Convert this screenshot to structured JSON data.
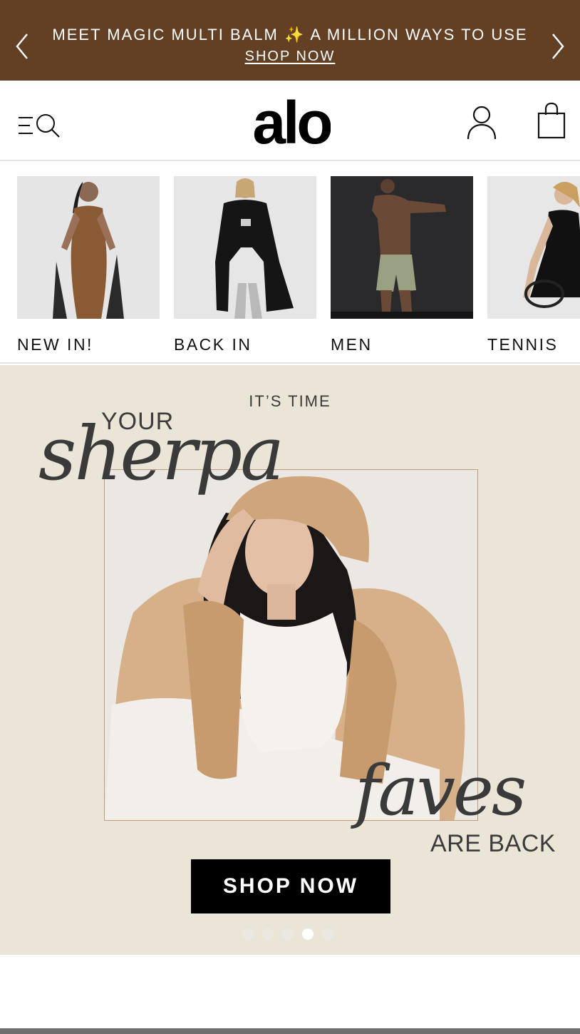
{
  "announcement": {
    "message_before": "MEET MAGIC MULTI BALM",
    "sparkle": "✨",
    "message_after": "A MILLION WAYS TO USE",
    "link_label": "SHOP NOW",
    "background_color": "#633f23"
  },
  "header": {
    "logo_text": "alo",
    "icons": [
      "menu-search-icon",
      "account-icon",
      "shopping-bag-icon"
    ]
  },
  "categories": [
    {
      "label": "NEW IN!"
    },
    {
      "label": "BACK IN"
    },
    {
      "label": "MEN"
    },
    {
      "label": "TENNIS"
    }
  ],
  "hero": {
    "kicker": "IT’S TIME",
    "headline_small_top": "YOUR",
    "headline_script_top": "sherpa",
    "headline_script_bottom": "faves",
    "headline_small_bottom": "ARE BACK",
    "cta_label": "SHOP NOW",
    "carousel_slide_count": 5,
    "carousel_active_index": 3
  }
}
